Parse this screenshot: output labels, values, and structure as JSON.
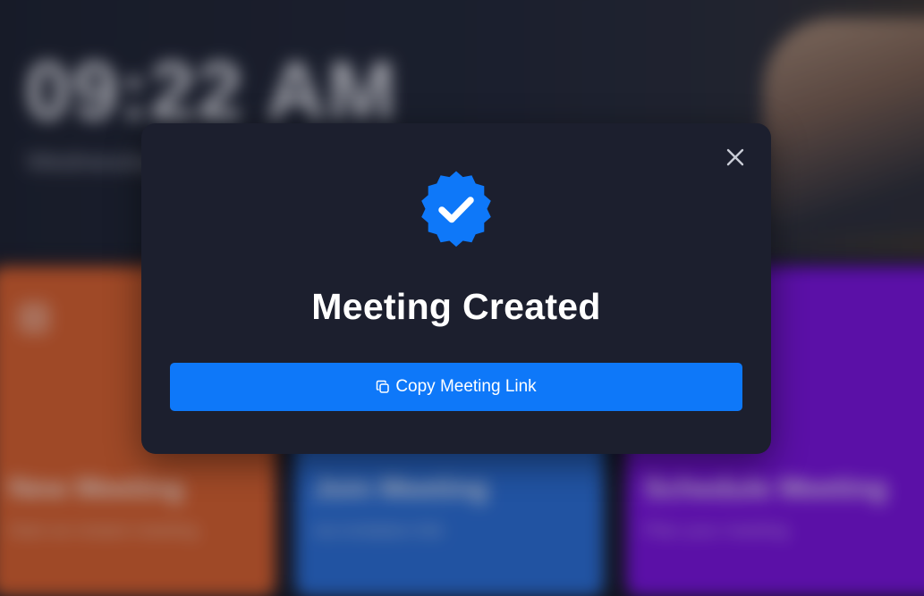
{
  "background": {
    "clock_time": "09:22 AM",
    "clock_date": "Wednesday",
    "cards": [
      {
        "title": "New Meeting",
        "subtitle": "Start an instant meeting",
        "color": "#d9612e"
      },
      {
        "title": "Join Meeting",
        "subtitle": "via invitation link",
        "color": "#2a6fd8"
      },
      {
        "title": "Schedule Meeting",
        "subtitle": "Plan your meeting",
        "color": "#7a12e0"
      }
    ]
  },
  "modal": {
    "icon": "verified-checkmark-icon",
    "title": "Meeting Created",
    "button_label": "Copy Meeting Link",
    "button_icon": "copy-icon",
    "close_icon": "close-icon",
    "accent_color": "#0e78f9",
    "background_color": "#1c1f2e"
  }
}
